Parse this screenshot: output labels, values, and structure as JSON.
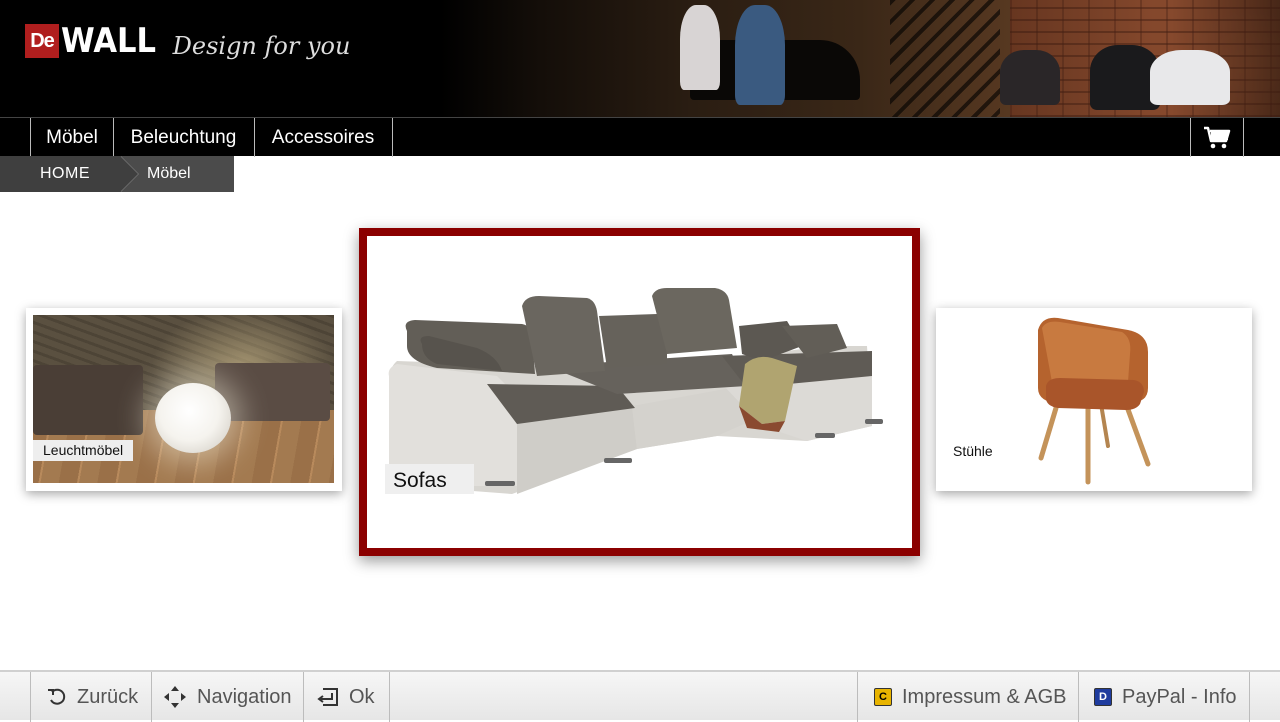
{
  "header": {
    "logo_prefix": "De",
    "logo_name": "WALL",
    "tagline": "Design for you"
  },
  "nav": {
    "items": [
      {
        "label": "Möbel"
      },
      {
        "label": "Beleuchtung"
      },
      {
        "label": "Accessoires"
      }
    ],
    "cart_icon": "shopping-cart-icon"
  },
  "breadcrumb": {
    "home": "HOME",
    "current": "Möbel"
  },
  "categories": {
    "left": {
      "label": "Leuchtmöbel"
    },
    "center": {
      "label": "Sofas",
      "selected": true
    },
    "right": {
      "label": "Stühle"
    }
  },
  "colors": {
    "selection_border": "#8b0000",
    "key_c": "#e8b400",
    "key_d": "#1f3c9e"
  },
  "footer": {
    "back": {
      "label": "Zurück",
      "icon": "undo-arrow-icon"
    },
    "navigation": {
      "label": "Navigation",
      "icon": "four-way-arrows-icon"
    },
    "ok": {
      "label": "Ok",
      "icon": "enter-icon"
    },
    "impressum": {
      "label": "Impressum & AGB",
      "key": "C"
    },
    "paypal": {
      "label": "PayPal - Info",
      "key": "D"
    }
  }
}
